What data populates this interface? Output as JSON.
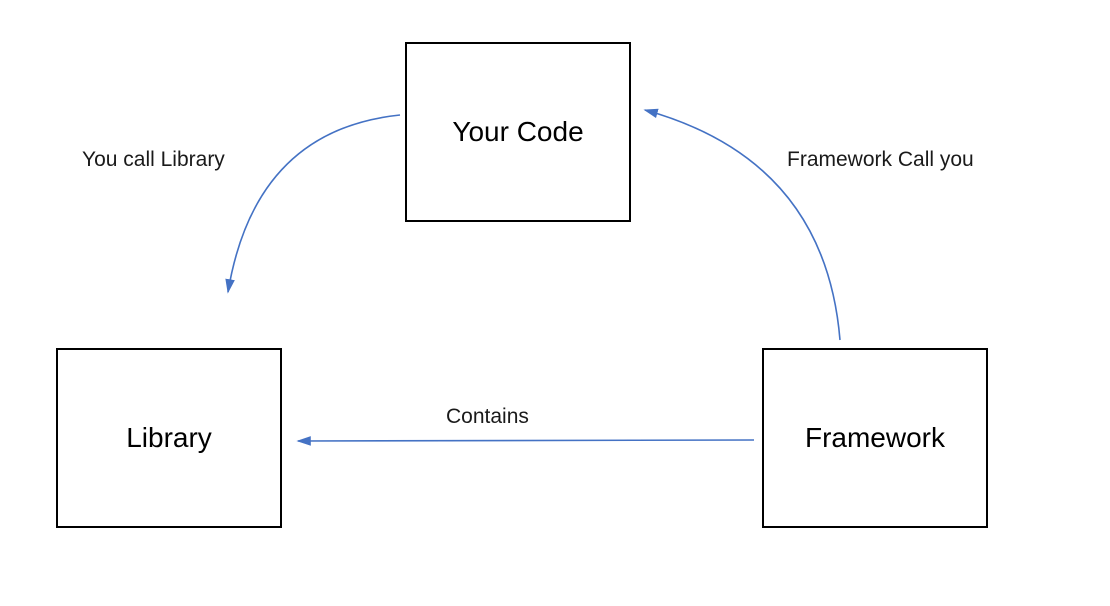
{
  "diagram": {
    "boxes": {
      "yourcode": "Your Code",
      "library": "Library",
      "framework": "Framework"
    },
    "labels": {
      "youcall": "You call Library",
      "frameworkcall": "Framework Call you",
      "contains": "Contains"
    },
    "colors": {
      "arrow": "#4472C4",
      "box_border": "#000000",
      "text": "#1a1a1a"
    },
    "relationships": [
      {
        "from": "yourcode",
        "to": "library",
        "label": "You call Library"
      },
      {
        "from": "framework",
        "to": "yourcode",
        "label": "Framework Call you"
      },
      {
        "from": "framework",
        "to": "library",
        "label": "Contains"
      }
    ]
  }
}
